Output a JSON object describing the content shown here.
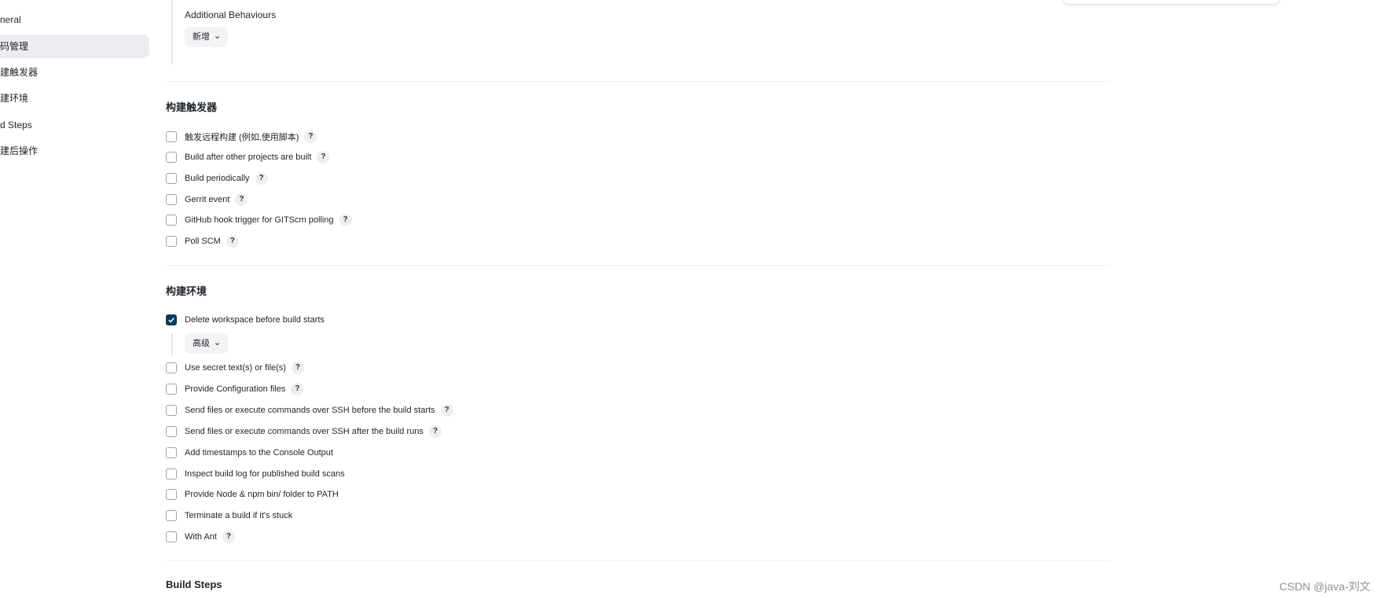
{
  "sidebar": {
    "items": [
      {
        "label": "neral",
        "active": false
      },
      {
        "label": "码管理",
        "active": true
      },
      {
        "label": "建触发器",
        "active": false
      },
      {
        "label": "建环境",
        "active": false
      },
      {
        "label": "d Steps",
        "active": false
      },
      {
        "label": "建后操作",
        "active": false
      }
    ]
  },
  "scm": {
    "additional_behaviours_label": "Additional Behaviours",
    "add_button_label": "新增"
  },
  "build_triggers": {
    "title": "构建触发器",
    "options": [
      {
        "label": "触发远程构建 (例如,使用脚本)",
        "checked": false,
        "help": "?"
      },
      {
        "label": "Build after other projects are built",
        "checked": false,
        "help": "?"
      },
      {
        "label": "Build periodically",
        "checked": false,
        "help": "?"
      },
      {
        "label": "Gerrit event",
        "checked": false,
        "help": "?"
      },
      {
        "label": "GitHub hook trigger for GITScm polling",
        "checked": false,
        "help": "?"
      },
      {
        "label": "Poll SCM",
        "checked": false,
        "help": "?"
      }
    ]
  },
  "build_env": {
    "title": "构建环境",
    "delete_workspace": {
      "label": "Delete workspace before build starts",
      "checked": true
    },
    "advanced_button_label": "高级",
    "options": [
      {
        "label": "Use secret text(s) or file(s)",
        "checked": false,
        "help": "?"
      },
      {
        "label": "Provide Configuration files",
        "checked": false,
        "help": "?"
      },
      {
        "label": "Send files or execute commands over SSH before the build starts",
        "checked": false,
        "help": "?"
      },
      {
        "label": "Send files or execute commands over SSH after the build runs",
        "checked": false,
        "help": "?"
      },
      {
        "label": "Add timestamps to the Console Output",
        "checked": false,
        "help": ""
      },
      {
        "label": "Inspect build log for published build scans",
        "checked": false,
        "help": ""
      },
      {
        "label": "Provide Node & npm bin/ folder to PATH",
        "checked": false,
        "help": ""
      },
      {
        "label": "Terminate a build if it's stuck",
        "checked": false,
        "help": ""
      },
      {
        "label": "With Ant",
        "checked": false,
        "help": "?"
      }
    ]
  },
  "build_steps": {
    "title": "Build Steps"
  },
  "watermark": "CSDN @java-刘文",
  "colors": {
    "checkbox_checked": "#0a3a5c",
    "sidebar_active_bg": "#ecedf2"
  }
}
